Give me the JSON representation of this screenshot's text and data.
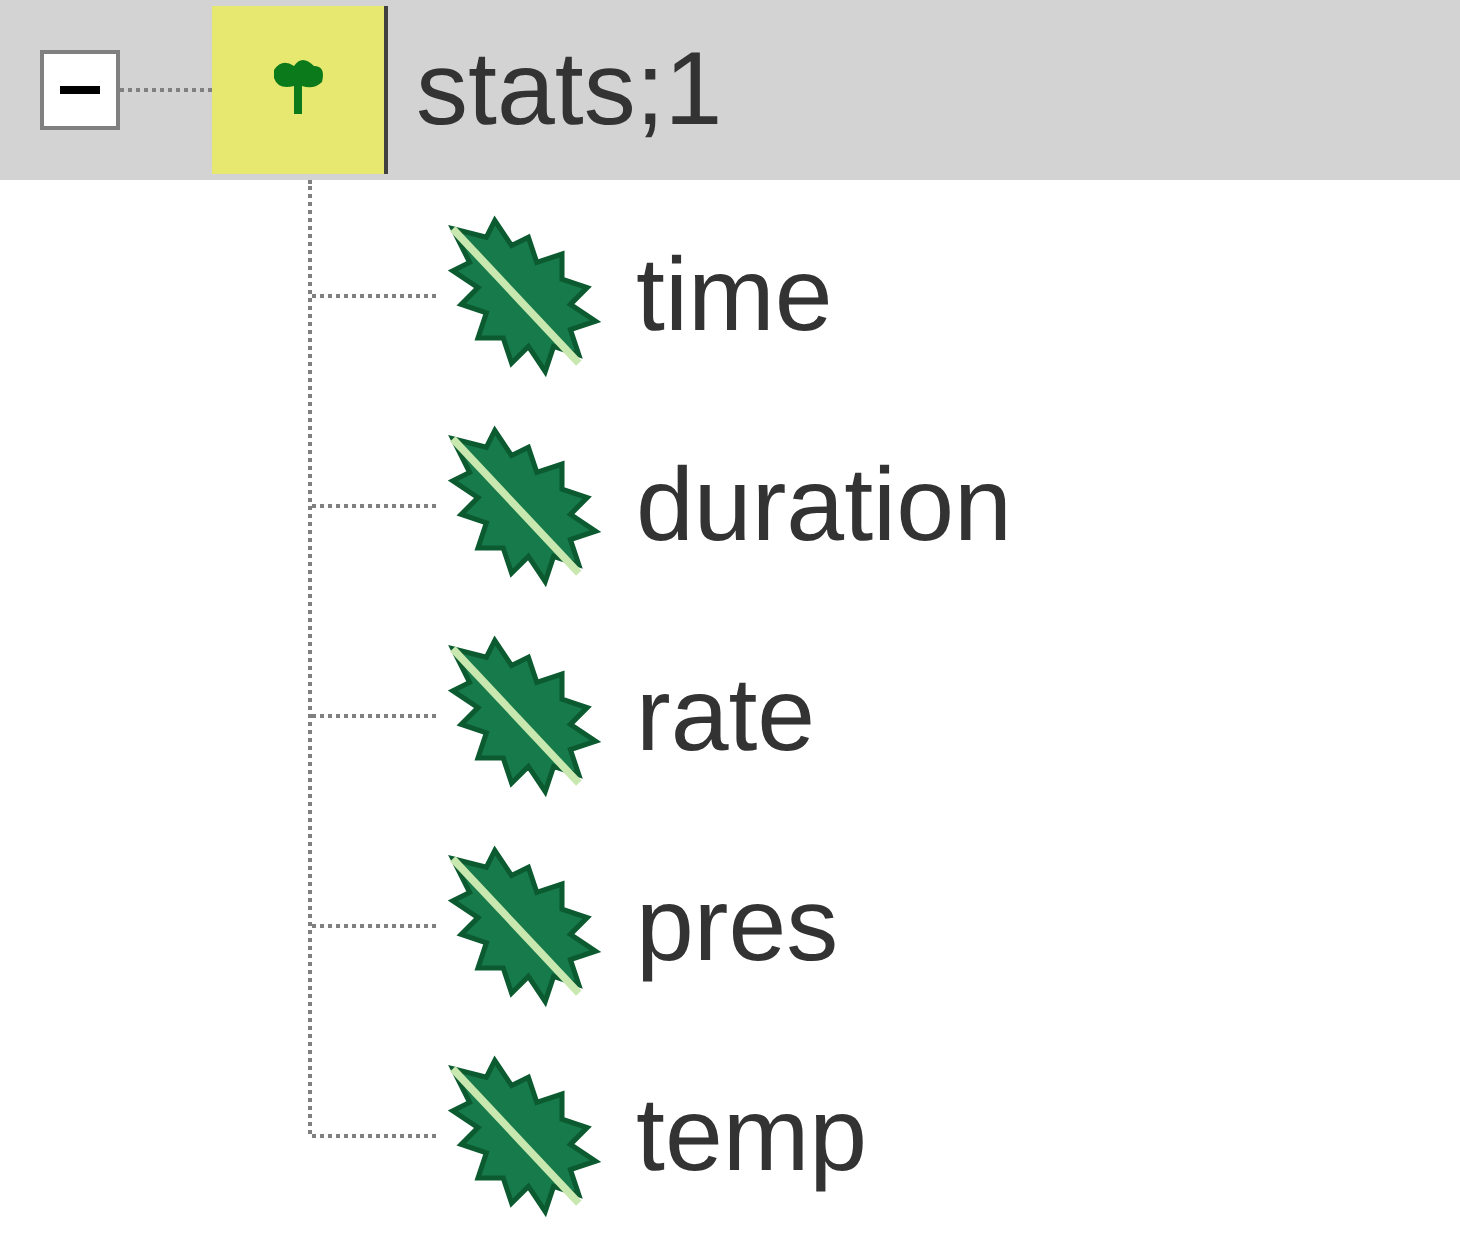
{
  "tree": [
    {
      "label": "stats;1",
      "expanded": true,
      "selected": true,
      "children": [
        {
          "label": "time",
          "selected": false
        },
        {
          "label": "duration",
          "selected": false
        },
        {
          "label": "rate",
          "selected": false
        },
        {
          "label": "pres",
          "selected": false
        },
        {
          "label": "temp",
          "selected": false
        }
      ]
    }
  ]
}
